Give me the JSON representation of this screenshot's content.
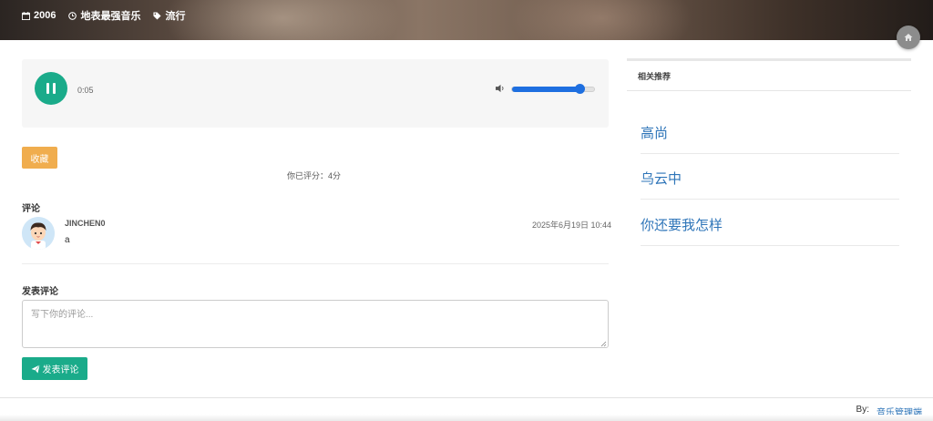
{
  "header": {
    "year": "2006",
    "artist": "地表最强音乐",
    "genre": "流行"
  },
  "player": {
    "current_time": "0:05",
    "volume": 0.82,
    "is_playing": true,
    "accent": "#1aab8a",
    "volume_color": "#1e6fe0"
  },
  "actions": {
    "favorite_label": "收藏",
    "rating_text": "你已评分：4分"
  },
  "comments": {
    "title": "评论",
    "items": [
      {
        "user": "JINCHEN0",
        "time": "2025年6月19日 10:44",
        "text": "a"
      }
    ]
  },
  "post": {
    "title": "发表评论",
    "placeholder": "写下你的评论...",
    "value": "",
    "submit_label": "发表评论"
  },
  "sidebar": {
    "title": "相关推荐",
    "items": [
      {
        "label": "高尚"
      },
      {
        "label": "乌云中"
      },
      {
        "label": "你还要我怎样"
      }
    ]
  },
  "footer": {
    "by_label": "By:",
    "link_label": "音乐管理端"
  },
  "icons": {
    "calendar": "calendar-icon",
    "clock": "clock-icon",
    "tag": "tag-icon",
    "home": "home-icon",
    "pause": "pause-icon",
    "volume": "volume-icon",
    "send": "paper-plane-icon"
  }
}
